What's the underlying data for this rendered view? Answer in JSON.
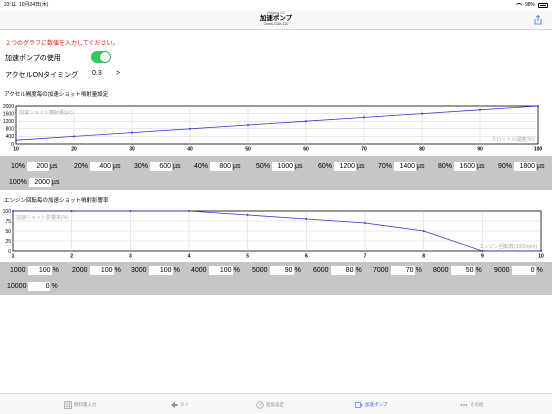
{
  "status": {
    "time": "23:11",
    "date": "10月24日(木)",
    "battery": "98%"
  },
  "nav": {
    "subtitle": "Enigma LC",
    "title": "加速ポンプ",
    "subtitle2": "Cross CUB 110"
  },
  "warning": "２つのグラフに数値を入力してください。",
  "pump_use_label": "加速ポンプの使用",
  "pump_use_on": true,
  "accel_on_timing_label": "アクセルONタイミング",
  "accel_on_timing_value": "0.3",
  "chevron": ">",
  "chart1_title": "アクセル開度毎の加速ショット噴射量設定",
  "chart2_title": "エンジン回転毎の加速ショット噴射影響率",
  "colors": {
    "line": "#3a3ad0",
    "grid": "#d0d0d0",
    "panel": "#c6c6c6",
    "accent": "#2f6fd8",
    "toggle": "#34c759",
    "warn": "#e02020"
  },
  "chart_data": [
    {
      "type": "line",
      "ylabel_inner": "加速ショット噴射量(µs)",
      "xlabel_inner": "スロットル開度(%)",
      "x": [
        10,
        20,
        30,
        40,
        50,
        60,
        70,
        80,
        90,
        100
      ],
      "y": [
        200,
        400,
        600,
        800,
        1000,
        1200,
        1400,
        1600,
        1800,
        2000
      ],
      "xticks": [
        "10",
        "20",
        "30",
        "40",
        "50",
        "60",
        "70",
        "80",
        "90",
        "100"
      ],
      "yticks": [
        "2000",
        "1600",
        "1200",
        "800",
        "400",
        "0"
      ],
      "xlim": [
        10,
        100
      ],
      "ylim": [
        0,
        2000
      ],
      "grid": true
    },
    {
      "type": "line",
      "ylabel_inner": "加速ショット影響率(%)",
      "xlabel_inner": "エンジン回転数(1000rpm)",
      "x": [
        1,
        2,
        3,
        4,
        5,
        6,
        7,
        8,
        9,
        10
      ],
      "y": [
        100,
        100,
        100,
        100,
        90,
        80,
        70,
        50,
        0,
        0
      ],
      "xticks": [
        "1",
        "2",
        "3",
        "4",
        "5",
        "6",
        "7",
        "8",
        "9",
        "10"
      ],
      "yticks": [
        "100",
        "75",
        "50",
        "25",
        "0"
      ],
      "xlim": [
        1,
        10
      ],
      "ylim": [
        0,
        100
      ],
      "grid": true
    }
  ],
  "throttle_inputs": [
    {
      "label": "10%",
      "value": "200",
      "unit": "µs"
    },
    {
      "label": "20%",
      "value": "400",
      "unit": "µs"
    },
    {
      "label": "30%",
      "value": "600",
      "unit": "µs"
    },
    {
      "label": "40%",
      "value": "800",
      "unit": "µs"
    },
    {
      "label": "50%",
      "value": "1000",
      "unit": "µs"
    },
    {
      "label": "60%",
      "value": "1200",
      "unit": "µs"
    },
    {
      "label": "70%",
      "value": "1400",
      "unit": "µs"
    },
    {
      "label": "80%",
      "value": "1600",
      "unit": "µs"
    },
    {
      "label": "90%",
      "value": "1800",
      "unit": "µs"
    },
    {
      "label": "100%",
      "value": "2000",
      "unit": "µs"
    }
  ],
  "rpm_inputs": [
    {
      "label": "1000",
      "value": "100",
      "unit": "%"
    },
    {
      "label": "2000",
      "value": "100",
      "unit": "%"
    },
    {
      "label": "3000",
      "value": "100",
      "unit": "%"
    },
    {
      "label": "4000",
      "value": "100",
      "unit": "%"
    },
    {
      "label": "5000",
      "value": "90",
      "unit": "%"
    },
    {
      "label": "6000",
      "value": "80",
      "unit": "%"
    },
    {
      "label": "7000",
      "value": "70",
      "unit": "%"
    },
    {
      "label": "8000",
      "value": "50",
      "unit": "%"
    },
    {
      "label": "9000",
      "value": "0",
      "unit": "%"
    },
    {
      "label": "10000",
      "value": "0",
      "unit": "%"
    }
  ],
  "tabs": [
    {
      "label": "燃料量入力",
      "icon": "grid-icon",
      "active": false
    },
    {
      "label": "タイ",
      "icon": "arrow-icon",
      "active": false
    },
    {
      "label": "進角設定",
      "icon": "gauge-icon",
      "active": false
    },
    {
      "label": "加速ポンプ",
      "icon": "pump-icon",
      "active": true
    },
    {
      "label": "その他",
      "icon": "more-icon",
      "active": false
    }
  ]
}
